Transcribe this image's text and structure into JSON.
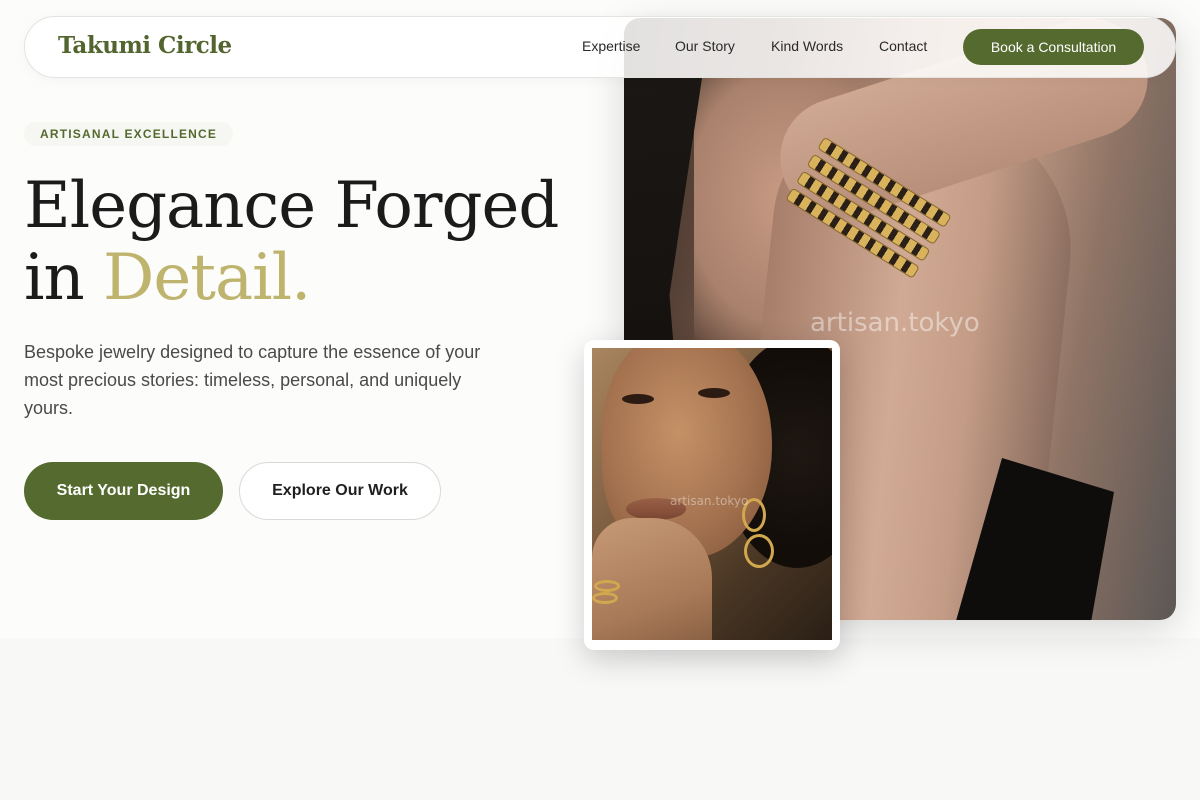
{
  "nav": {
    "brand": "Takumi Circle",
    "links": [
      "Expertise",
      "Our Story",
      "Kind Words",
      "Contact"
    ],
    "cta": "Book a Consultation"
  },
  "hero": {
    "eyebrow": "ARTISANAL EXCELLENCE",
    "headline_line1": "Elegance Forged",
    "headline_line2_prefix": "in ",
    "headline_accent": "Detail.",
    "lede": "Bespoke jewelry designed to capture the essence of your most precious stories: timeless, personal, and uniquely yours.",
    "primary_button": "Start Your Design",
    "secondary_button": "Explore Our Work"
  },
  "images": {
    "main_watermark": "artisan.tokyo",
    "card_watermark": "artisan.tokyo"
  },
  "colors": {
    "brand_green": "#556a2f",
    "accent_gold": "#bfb46d",
    "background": "#fcfcfb"
  }
}
